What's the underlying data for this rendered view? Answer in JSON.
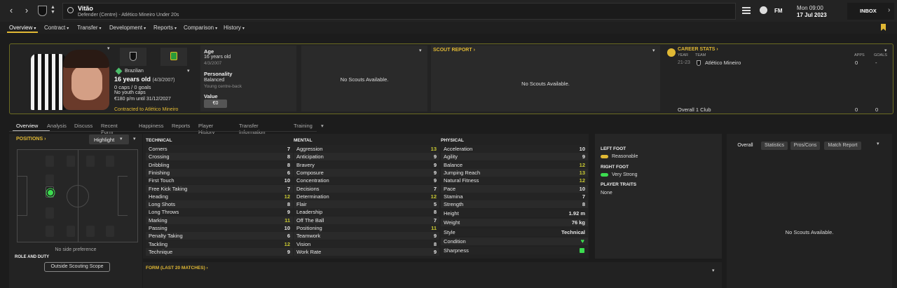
{
  "header": {
    "player_name": "Vitão",
    "player_subtitle": "Defender (Centre) - Atlético Mineiro Under 20s",
    "datetime_day": "Mon 09:00",
    "datetime_date": "17 Jul 2023",
    "inbox_label": "INBOX",
    "fm_label": "FM"
  },
  "menu": [
    {
      "label": "Overview",
      "active": true
    },
    {
      "label": "Contract"
    },
    {
      "label": "Transfer"
    },
    {
      "label": "Development"
    },
    {
      "label": "Reports"
    },
    {
      "label": "Comparison"
    },
    {
      "label": "History"
    }
  ],
  "profile": {
    "nationality": "Brazilian",
    "age_line": "16 years old",
    "dob_paren": "(4/3/2007)",
    "caps": "0 caps / 0 goals",
    "youth_caps": "No youth caps",
    "wage": "€180 p/m until 31/12/2027",
    "contracted": "Contracted to Atlético Mineiro"
  },
  "info": {
    "age_label": "Age",
    "age_value": "16 years old",
    "age_date": "4/3/2007",
    "personality_label": "Personality",
    "personality_value": "Balanced",
    "personality_sub": "Young centre-back",
    "value_label": "Value",
    "value_value": "€0"
  },
  "scouts": {
    "no_scouts_1": "No Scouts Available.",
    "scout_report_label": "SCOUT REPORT",
    "no_scouts_2": "No Scouts Available."
  },
  "career": {
    "title": "CAREER STATS",
    "col_year": "YEAR",
    "col_team": "TEAM",
    "col_apps": "APPS",
    "col_goals": "GOALS",
    "row_year": "21-23",
    "row_team": "Atlético Mineiro",
    "row_apps": "0",
    "row_goals": "-",
    "total_label": "Overall 1 Club",
    "total_apps": "0",
    "total_goals": "0"
  },
  "subtabs": [
    "Overview",
    "Analysis",
    "Discuss",
    "Recent Form",
    "Happiness",
    "Reports",
    "Player History",
    "Transfer Information",
    "Training"
  ],
  "positions": {
    "title": "POSITIONS",
    "highlight": "Highlight",
    "side_pref": "No side preference",
    "role_duty": "ROLE AND DUTY",
    "scope_btn": "Outside Scouting Scope"
  },
  "technical": {
    "title": "TECHNICAL",
    "rows": [
      {
        "n": "Corners",
        "v": "7"
      },
      {
        "n": "Crossing",
        "v": "8"
      },
      {
        "n": "Dribbling",
        "v": "8"
      },
      {
        "n": "Finishing",
        "v": "6"
      },
      {
        "n": "First Touch",
        "v": "10"
      },
      {
        "n": "Free Kick Taking",
        "v": "7"
      },
      {
        "n": "Heading",
        "v": "12"
      },
      {
        "n": "Long Shots",
        "v": "8"
      },
      {
        "n": "Long Throws",
        "v": "9"
      },
      {
        "n": "Marking",
        "v": "11"
      },
      {
        "n": "Passing",
        "v": "10"
      },
      {
        "n": "Penalty Taking",
        "v": "6"
      },
      {
        "n": "Tackling",
        "v": "12"
      },
      {
        "n": "Technique",
        "v": "9"
      }
    ]
  },
  "mental": {
    "title": "MENTAL",
    "rows": [
      {
        "n": "Aggression",
        "v": "13"
      },
      {
        "n": "Anticipation",
        "v": "9"
      },
      {
        "n": "Bravery",
        "v": "9"
      },
      {
        "n": "Composure",
        "v": "9"
      },
      {
        "n": "Concentration",
        "v": "9"
      },
      {
        "n": "Decisions",
        "v": "7"
      },
      {
        "n": "Determination",
        "v": "12"
      },
      {
        "n": "Flair",
        "v": "5"
      },
      {
        "n": "Leadership",
        "v": "8"
      },
      {
        "n": "Off The Ball",
        "v": "7"
      },
      {
        "n": "Positioning",
        "v": "11"
      },
      {
        "n": "Teamwork",
        "v": "9"
      },
      {
        "n": "Vision",
        "v": "8"
      },
      {
        "n": "Work Rate",
        "v": "9"
      }
    ]
  },
  "physical": {
    "title": "PHYSICAL",
    "rows": [
      {
        "n": "Acceleration",
        "v": "10"
      },
      {
        "n": "Agility",
        "v": "9"
      },
      {
        "n": "Balance",
        "v": "12"
      },
      {
        "n": "Jumping Reach",
        "v": "13"
      },
      {
        "n": "Natural Fitness",
        "v": "12"
      },
      {
        "n": "Pace",
        "v": "10"
      },
      {
        "n": "Stamina",
        "v": "7"
      },
      {
        "n": "Strength",
        "v": "8"
      }
    ],
    "height_label": "Height",
    "height_value": "1.92 m",
    "weight_label": "Weight",
    "weight_value": "76 kg",
    "style_label": "Style",
    "style_value": "Technical",
    "condition_label": "Condition",
    "sharpness_label": "Sharpness"
  },
  "foot": {
    "left_title": "LEFT FOOT",
    "left_value": "Reasonable",
    "right_title": "RIGHT FOOT",
    "right_value": "Very Strong",
    "traits_title": "PLAYER TRAITS",
    "traits_value": "None"
  },
  "right_panel": {
    "tabs": [
      "Overall",
      "Statistics",
      "Pros/Cons",
      "Match Report"
    ],
    "no_scouts": "No Scouts Available."
  },
  "form": {
    "title": "FORM (LAST 20 MATCHES)"
  },
  "colors": {
    "accent": "#e0b834",
    "highlight_value": "#c8c832",
    "good": "#3cdc50"
  }
}
